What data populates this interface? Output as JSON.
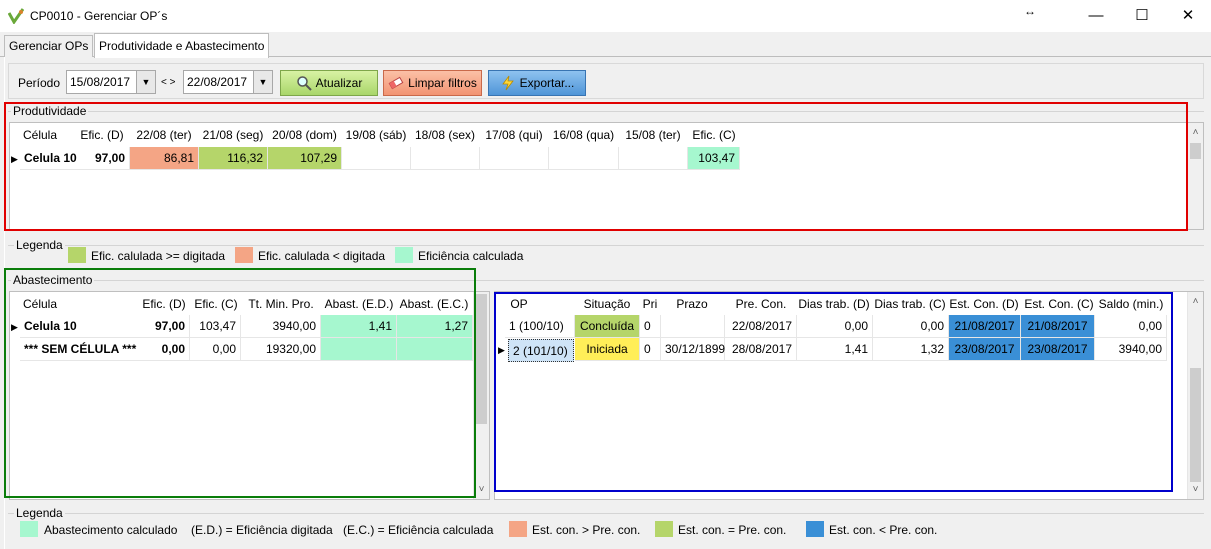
{
  "window": {
    "title": "CP0010 - Gerenciar OP´s",
    "minimize": "—",
    "maximize": "☐",
    "close": "✕",
    "resize_glyph": "↔"
  },
  "tabs": [
    {
      "label": "Gerenciar OPs",
      "active": false
    },
    {
      "label": "Produtividade e Abastecimento",
      "active": true
    }
  ],
  "toolbar": {
    "period_label": "Período",
    "date_from": "15/08/2017",
    "date_sep": "< >",
    "date_to": "22/08/2017",
    "update_label": "Atualizar",
    "clear_label": "Limpar filtros",
    "export_label": "Exportar..."
  },
  "produtividade": {
    "title": "Produtividade",
    "headers": [
      "Célula",
      "Efic. (D)",
      "22/08 (ter)",
      "21/08 (seg)",
      "20/08 (dom)",
      "19/08 (sáb)",
      "18/08 (sex)",
      "17/08 (qui)",
      "16/08 (qua)",
      "15/08 (ter)",
      "Efic. (C)"
    ],
    "rows": [
      [
        "Celula 10",
        "97,00",
        "86,81",
        "116,32",
        "107,29",
        "",
        "",
        "",
        "",
        "",
        "103,47"
      ]
    ]
  },
  "legenda1": {
    "title": "Legenda",
    "items": [
      "Efic. calulada >= digitada",
      "Efic. calulada < digitada",
      "Eficiência calculada"
    ]
  },
  "abastecimento": {
    "title": "Abastecimento",
    "headers": [
      "Célula",
      "Efic. (D)",
      "Efic. (C)",
      "Tt. Min. Pro.",
      "Abast. (E.D.)",
      "Abast. (E.C.)"
    ],
    "rows": [
      [
        "Celula 10",
        "97,00",
        "103,47",
        "3940,00",
        "1,41",
        "1,27"
      ],
      [
        "*** SEM CÉLULA ***",
        "0,00",
        "0,00",
        "19320,00",
        "",
        ""
      ]
    ]
  },
  "ops": {
    "headers": [
      "OP",
      "Situação",
      "Pri",
      "Prazo",
      "Pre. Con.",
      "Dias trab. (D)",
      "Dias trab. (C)",
      "Est. Con. (D)",
      "Est. Con. (C)",
      "Saldo (min.)"
    ],
    "rows": [
      [
        "1 (100/10)",
        "Concluída",
        "0",
        "",
        "22/08/2017",
        "0,00",
        "0,00",
        "21/08/2017",
        "21/08/2017",
        "0,00"
      ],
      [
        "2 (101/10)",
        "Iniciada",
        "0",
        "30/12/1899",
        "28/08/2017",
        "1,41",
        "1,32",
        "23/08/2017",
        "23/08/2017",
        "3940,00"
      ]
    ]
  },
  "legenda2": {
    "title": "Legenda",
    "item1": "Abastecimento calculado",
    "item2": "(E.D.) = Eficiência digitada",
    "item3": "(E.C.) = Eficiência calculada",
    "item4": "Est. con. > Pre. con.",
    "item5": "Est. con. = Pre. con.",
    "item6": "Est. con. < Pre. con."
  },
  "colors": {
    "green": "#b5d56a",
    "salmon": "#f4a585",
    "mint": "#a6f7cf",
    "yellow": "#ffee58",
    "blue": "#3a8fd6",
    "red_box": "#e00000",
    "green_box": "#0a7d0a",
    "blue_box": "#0000cc"
  }
}
